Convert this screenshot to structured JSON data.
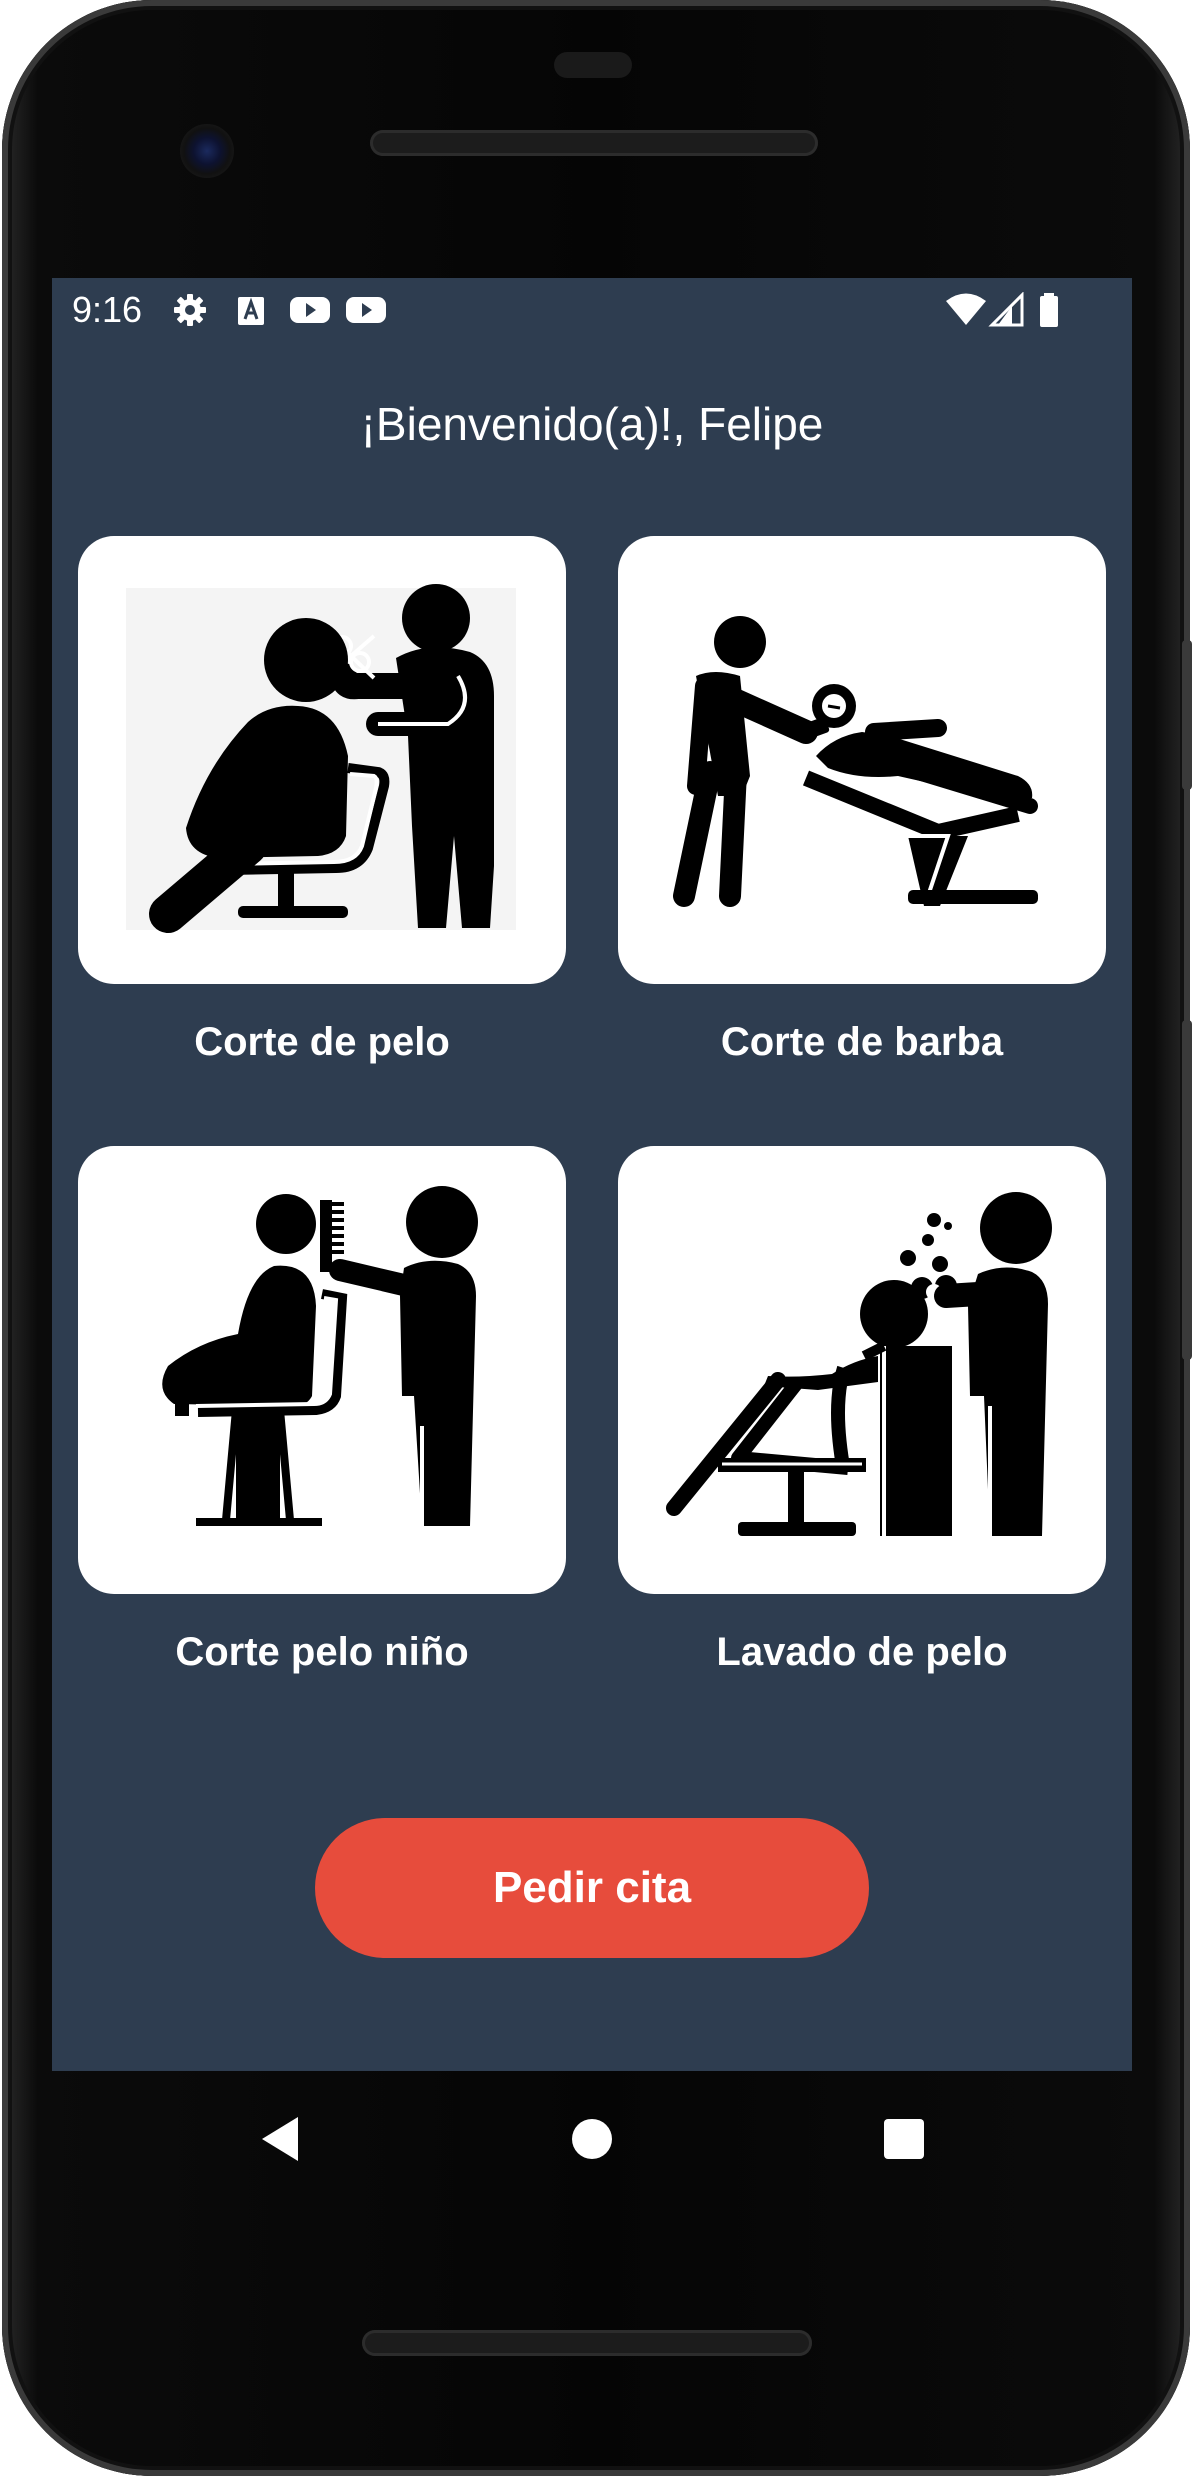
{
  "status_bar": {
    "time": "9:16",
    "icons_left": [
      "gear-icon",
      "text-a-icon",
      "youtube-icon",
      "youtube-icon"
    ],
    "icons_right": [
      "wifi-icon",
      "signal-icon",
      "battery-icon"
    ]
  },
  "welcome": {
    "text": "¡Bienvenido(a)!, Felipe"
  },
  "services": [
    {
      "label": "Corte de pelo",
      "icon": "haircut-icon"
    },
    {
      "label": "Corte de barba",
      "icon": "beard-trim-icon"
    },
    {
      "label": "Corte pelo niño",
      "icon": "kids-haircut-icon"
    },
    {
      "label": "Lavado de pelo",
      "icon": "hair-wash-icon"
    }
  ],
  "cta": {
    "label": "Pedir cita"
  },
  "nav_bar": {
    "buttons": [
      "back-icon",
      "home-icon",
      "recents-icon"
    ]
  },
  "colors": {
    "background": "#2e3d50",
    "accent": "#e74c3c",
    "card": "#ffffff",
    "text": "#ffffff"
  }
}
